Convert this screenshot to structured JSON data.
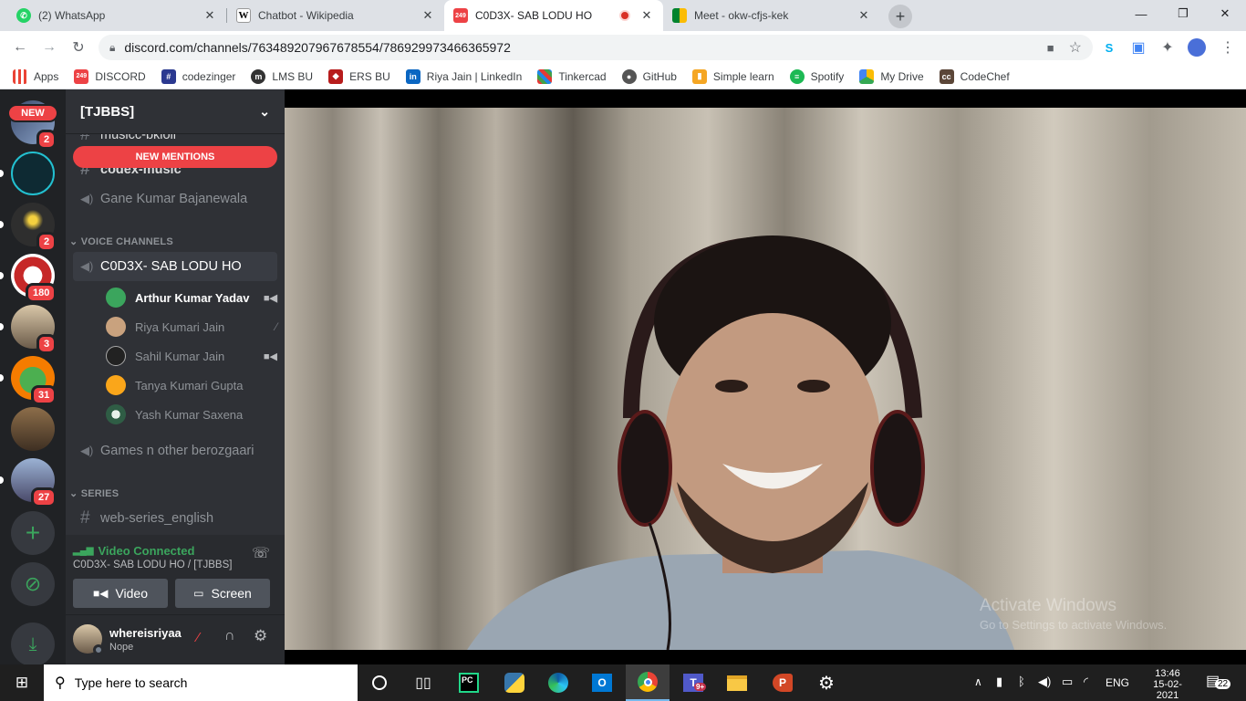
{
  "browser": {
    "tabs": [
      {
        "title": "(2) WhatsApp",
        "active": false
      },
      {
        "title": "Chatbot - Wikipedia",
        "active": false
      },
      {
        "title": "C0D3X- SAB LODU HO",
        "active": true
      },
      {
        "title": "Meet - okw-cfjs-kek",
        "active": false
      }
    ],
    "url": "discord.com/channels/763489207967678554/786929973466365972",
    "bookmarks": [
      "Apps",
      "DISCORD",
      "codezinger",
      "LMS BU",
      "ERS BU",
      "Riya Jain | LinkedIn",
      "Tinkercad",
      "GitHub",
      "Simple learn",
      "Spotify",
      "My Drive",
      "CodeChef"
    ],
    "discord_fav_badge": "249"
  },
  "rail": {
    "new_pill": "NEW",
    "badges": [
      "2",
      "2",
      "180",
      "3",
      "31",
      "27"
    ]
  },
  "channels": {
    "server_name": "[TJBBS]",
    "new_mentions": "NEW MENTIONS",
    "partial_top": "musicc-bkloll",
    "top_channel": "codex-music",
    "voice_top": "Gane Kumar Bajanewala",
    "category_voice": "VOICE CHANNELS",
    "active_voice": "C0D3X- SAB LODU HO",
    "voice_users": [
      {
        "name": "Arthur Kumar Yadav",
        "color": "#3ba55d",
        "video": true,
        "muted": false
      },
      {
        "name": "Riya Kumari Jain",
        "color": "#c9a27e",
        "video": false,
        "muted": true
      },
      {
        "name": "Sahil Kumar Jain",
        "color": "#222222",
        "video": true,
        "muted": false
      },
      {
        "name": "Tanya Kumari Gupta",
        "color": "#faa61a",
        "video": false,
        "muted": false
      },
      {
        "name": "Yash Kumar Saxena",
        "color": "#5c8a6a",
        "video": false,
        "muted": false
      }
    ],
    "voice_other": "Games n other berozgaari",
    "category_series": "SERIES",
    "series_channel": "web-series_english"
  },
  "voice_panel": {
    "status": "Video Connected",
    "location": "C0D3X- SAB LODU HO / [TJBBS]",
    "video_btn": "Video",
    "screen_btn": "Screen"
  },
  "user": {
    "name": "whereisriyaa",
    "status": "Nope"
  },
  "video": {
    "watermark_line1": "Activate Windows",
    "watermark_line2": "Go to Settings to activate Windows."
  },
  "taskbar": {
    "search_placeholder": "Type here to search",
    "time": "13:46",
    "date": "15-02-2021",
    "lang": "ENG",
    "notifications": "22",
    "teams_badge": "9+"
  }
}
